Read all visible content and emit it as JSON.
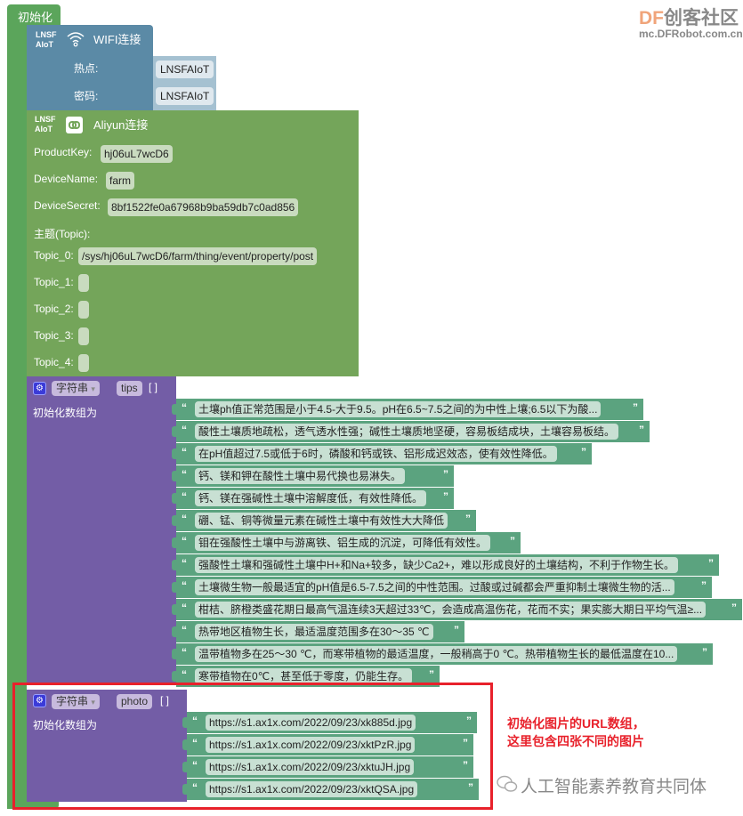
{
  "watermark_top": {
    "brand_df": "DF",
    "brand_cn": "创客社区",
    "url": "mc.DFRobot.com.cn",
    "df_color": "#f0a47a",
    "cn_color": "#888888"
  },
  "init_block": {
    "label": "初始化",
    "color": "#5ba55b"
  },
  "wifi_block": {
    "badge_line1": "LNSF",
    "badge_line2": "AIoT",
    "icon": "wifi-icon",
    "title": "WIFI连接",
    "hotspot_label": "热点:",
    "hotspot_value": "LNSFAIoT",
    "password_label": "密码:",
    "password_value": "LNSFAIoT",
    "color": "#5b8aa6"
  },
  "aliyun_block": {
    "badge_line1": "LNSF",
    "badge_line2": "AIoT",
    "icon": "link-icon",
    "title": "Aliyun连接",
    "product_key_label": "ProductKey:",
    "product_key": "hj06uL7wcD6",
    "device_name_label": "DeviceName:",
    "device_name": "farm",
    "device_secret_label": "DeviceSecret:",
    "device_secret": "8bf1522fe0a67968b9ba59db7c0ad856",
    "topic_heading": "主题(Topic):",
    "topics": [
      {
        "label": "Topic_0:",
        "value": "/sys/hj06uL7wcD6/farm/thing/event/property/post"
      },
      {
        "label": "Topic_1:",
        "value": ""
      },
      {
        "label": "Topic_2:",
        "value": ""
      },
      {
        "label": "Topic_3:",
        "value": ""
      },
      {
        "label": "Topic_4:",
        "value": ""
      }
    ],
    "color": "#74a55a"
  },
  "tips_block": {
    "type": "字符串",
    "name": "tips",
    "brackets": "[ ]",
    "init_label": "初始化数组为",
    "open_quote": "“",
    "close_quote": "”",
    "items": [
      "土壤ph值正常范围是小于4.5-大于9.5。pH在6.5~7.5之间的为中性上壤;6.5以下为酸...",
      "酸性土壤质地疏松，透气透水性强；碱性土壤质地坚硬，容易板结成块，土壤容易板结。",
      "在pH值超过7.5或低于6时，磷酸和钙或铁、铝形成迟效态，使有效性降低。",
      "钙、镁和钾在酸性土壤中易代换也易淋失。",
      "钙、镁在强碱性土壤中溶解度低，有效性降低。",
      "硼、锰、铜等微量元素在碱性土壤中有效性大大降低",
      "钼在强酸性土壤中与游离铁、铝生成的沉淀，可降低有效性。",
      "强酸性土壤和强碱性土壤中H+和Na+较多，缺少Ca2+，难以形成良好的土壤结构，不利于作物生长。",
      "土壤微生物一般最适宜的pH值是6.5-7.5之间的中性范围。过酸或过碱都会严重抑制土壤微生物的活...",
      "柑桔、脐橙类盛花期日最高气温连续3天超过33℃，会造成高温伤花，花而不实；果实膨大期日平均气温≥...",
      "热带地区植物生长，最适温度范围多在30～35 ℃",
      "温带植物多在25～30 ℃，而寒带植物的最适温度，一般稍高于0 ℃。热带植物生长的最低温度在10...",
      "寒带植物在0℃，甚至低于零度，仍能生存。"
    ]
  },
  "photo_block": {
    "type": "字符串",
    "name": "photo",
    "brackets": "[ ]",
    "init_label": "初始化数组为",
    "open_quote": "“",
    "close_quote": "”",
    "items": [
      "https://s1.ax1x.com/2022/09/23/xk885d.jpg",
      "https://s1.ax1x.com/2022/09/23/xktPzR.jpg",
      "https://s1.ax1x.com/2022/09/23/xktuJH.jpg",
      "https://s1.ax1x.com/2022/09/23/xktQSA.jpg"
    ]
  },
  "annotation": {
    "line1": "初始化图片的URL数组，",
    "line2": "这里包含四张不同的图片",
    "color": "#e8212b"
  },
  "watermark_bottom": {
    "icon": "wechat-icon",
    "text": "人工智能素养教育共同体"
  }
}
